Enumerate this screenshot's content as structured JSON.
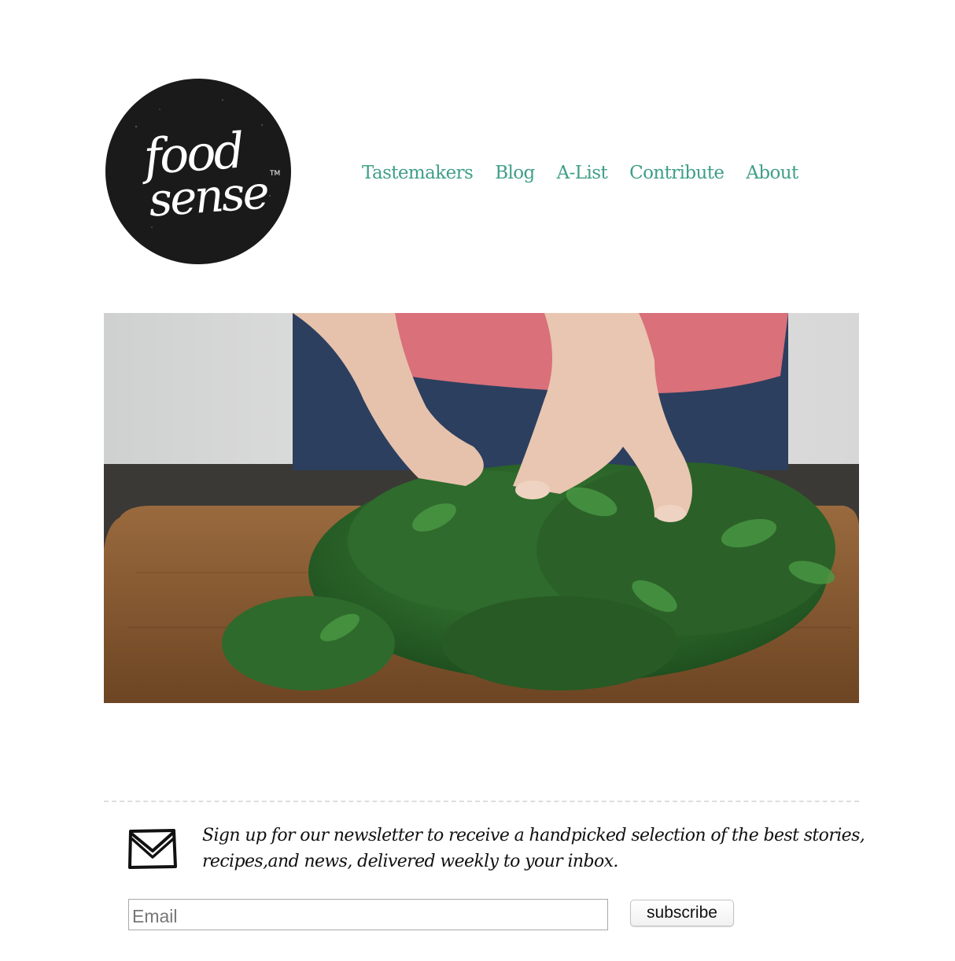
{
  "brand": {
    "logo_text_line1": "food",
    "logo_text_line2": "sense",
    "logo_trademark": "TM",
    "logo_bg_color": "#1a1a1a",
    "accent_color": "#3f9f87"
  },
  "nav": {
    "items": [
      {
        "label": "Tastemakers"
      },
      {
        "label": "Blog"
      },
      {
        "label": "A-List"
      },
      {
        "label": "Contribute"
      },
      {
        "label": "About"
      }
    ]
  },
  "hero": {
    "subject": "hands picking fresh parsley on a wooden cutting board"
  },
  "newsletter": {
    "icon": "envelope-icon",
    "text": "Sign up for our newsletter to receive a handpicked selection of the best stories, recipes,and news, delivered weekly to your inbox.",
    "email_placeholder": "Email",
    "email_value": "",
    "subscribe_label": "subscribe"
  }
}
